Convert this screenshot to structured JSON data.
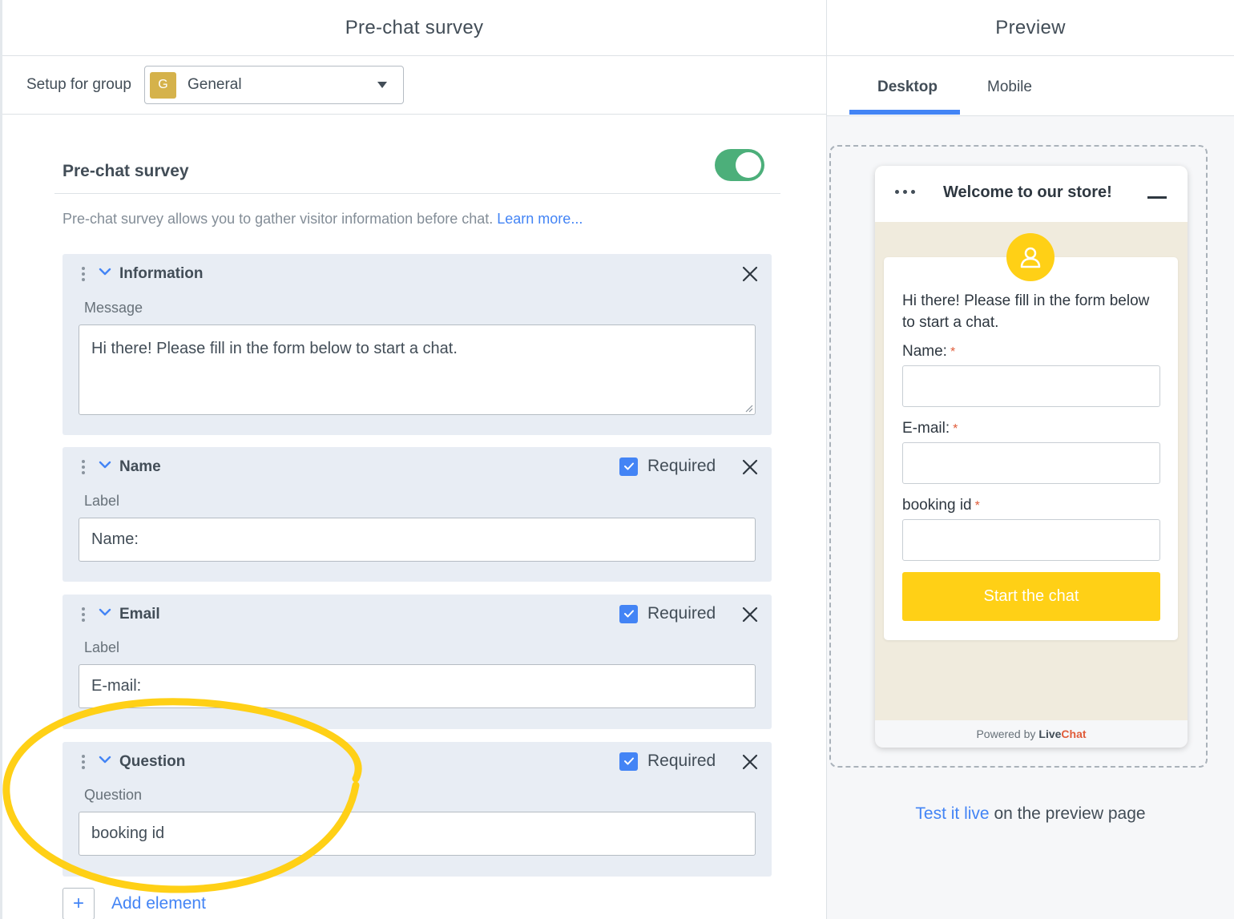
{
  "left": {
    "title": "Pre-chat survey",
    "setup_label": "Setup for group",
    "group": {
      "badge": "G",
      "name": "General"
    },
    "survey": {
      "title": "Pre-chat survey",
      "enabled": true,
      "description": "Pre-chat survey allows you to gather visitor information before chat.",
      "learn_more": "Learn more..."
    },
    "cards": [
      {
        "title": "Information",
        "field_label": "Message",
        "value": "Hi there! Please fill in the form below to start a chat."
      },
      {
        "title": "Name",
        "required_label": "Required",
        "field_label": "Label",
        "value": "Name:"
      },
      {
        "title": "Email",
        "required_label": "Required",
        "field_label": "Label",
        "value": "E-mail:"
      },
      {
        "title": "Question",
        "required_label": "Required",
        "field_label": "Question",
        "value": "booking id"
      }
    ],
    "add_element": "Add element",
    "add_icon": "+"
  },
  "right": {
    "title": "Preview",
    "tabs": [
      "Desktop",
      "Mobile"
    ],
    "active_tab": "Desktop",
    "widget": {
      "title": "Welcome to our store!",
      "intro": "Hi there! Please fill in the form below to start a chat.",
      "fields": [
        {
          "label": "Name:",
          "required": "*"
        },
        {
          "label": "E-mail:",
          "required": "*"
        },
        {
          "label": "booking id",
          "required": "*"
        }
      ],
      "submit": "Start the chat",
      "powered_prefix": "Powered by",
      "brand_a": "Live",
      "brand_b": "Chat"
    },
    "test_live_link": "Test it live",
    "test_live_rest": " on the preview page"
  },
  "colors": {
    "accent": "#4384f5",
    "toggle_on": "#4caf7a",
    "widget_yellow": "#ffd016",
    "card_bg": "#e8edf4",
    "group_badge": "#d5b24b",
    "highlight": "#ffd016"
  }
}
